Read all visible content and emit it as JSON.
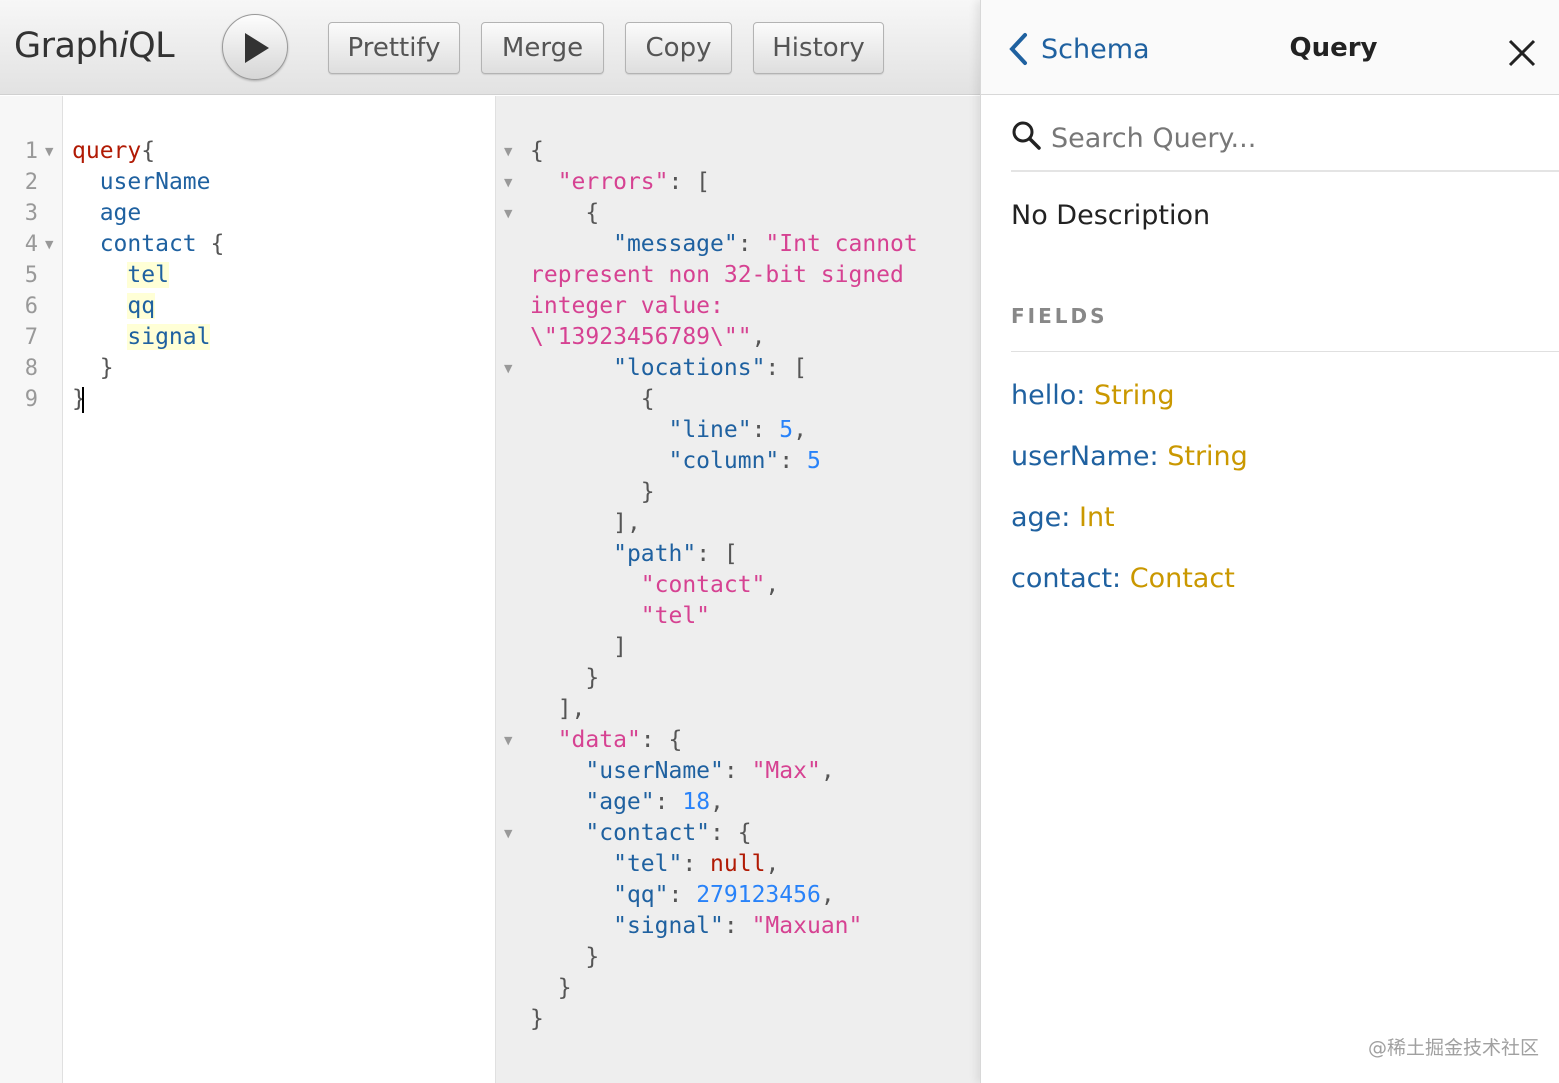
{
  "toolbar": {
    "logo_pre": "Graph",
    "logo_i": "i",
    "logo_post": "QL",
    "buttons": [
      "Prettify",
      "Merge",
      "Copy",
      "History"
    ]
  },
  "editor": {
    "line_numbers": [
      "1",
      "2",
      "3",
      "4",
      "5",
      "6",
      "7",
      "8",
      "9"
    ],
    "lines": {
      "l1": "query",
      "l1b": "{",
      "l2": "userName",
      "l3": "age",
      "l4": "contact",
      "l4b": " {",
      "l5": "tel",
      "l6": "qq",
      "l7": "signal",
      "l8": "}",
      "l9": "}"
    }
  },
  "result": {
    "r1": "{",
    "r2k": "\"errors\"",
    "r2p": ": [",
    "r3": "{",
    "r4k": "\"message\"",
    "r4p": ": ",
    "r4v": "\"Int cannot",
    "r5": "represent non 32-bit signed",
    "r6": "integer value:",
    "r7": "\\\"13923456789\\\"\"",
    "r7p": ",",
    "r8k": "\"locations\"",
    "r8p": ": [",
    "r9": "{",
    "r10k": "\"line\"",
    "r10p": ": ",
    "r10v": "5",
    "r10c": ",",
    "r11k": "\"column\"",
    "r11p": ": ",
    "r11v": "5",
    "r12": "}",
    "r13": "],",
    "r14k": "\"path\"",
    "r14p": ": [",
    "r15v": "\"contact\"",
    "r15c": ",",
    "r16v": "\"tel\"",
    "r17": "]",
    "r18": "}",
    "r19": "],",
    "r20k": "\"data\"",
    "r20p": ": {",
    "r21k": "\"userName\"",
    "r21p": ": ",
    "r21v": "\"Max\"",
    "r21c": ",",
    "r22k": "\"age\"",
    "r22p": ": ",
    "r22v": "18",
    "r22c": ",",
    "r23k": "\"contact\"",
    "r23p": ": {",
    "r24k": "\"tel\"",
    "r24p": ": ",
    "r24v": "null",
    "r24c": ",",
    "r25k": "\"qq\"",
    "r25p": ": ",
    "r25v": "279123456",
    "r25c": ",",
    "r26k": "\"signal\"",
    "r26p": ": ",
    "r26v": "\"Maxuan\"",
    "r27": "}",
    "r28": "}",
    "r29": "}"
  },
  "docs": {
    "back_label": "Schema",
    "title": "Query",
    "search_placeholder": "Search Query...",
    "description": "No Description",
    "fields_label": "FIELDS",
    "fields": [
      {
        "name": "hello",
        "type": "String"
      },
      {
        "name": "userName",
        "type": "String"
      },
      {
        "name": "age",
        "type": "Int"
      },
      {
        "name": "contact",
        "type": "Contact"
      }
    ]
  },
  "watermark": "@稀土掘金技术社区",
  "colors": {
    "keyword": "#b11a04",
    "field": "#1f61a0",
    "string": "#d64292",
    "number": "#2882f9",
    "type": "#ca9800"
  }
}
